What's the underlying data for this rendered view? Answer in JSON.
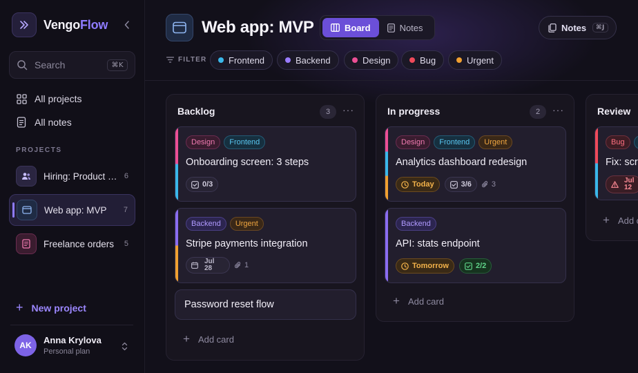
{
  "sidebar": {
    "brand_main": "Vengo",
    "brand_accent": "Flow",
    "search_placeholder": "Search",
    "search_shortcut": "⌘K",
    "nav": [
      {
        "label": "All projects",
        "icon": "grid-icon"
      },
      {
        "label": "All notes",
        "icon": "note-icon"
      }
    ],
    "section_label": "PROJECTS",
    "projects": [
      {
        "name": "Hiring: Product …",
        "count": "6",
        "icon": "people-icon",
        "color": "#2a2540"
      },
      {
        "name": "Web app: MVP",
        "count": "7",
        "icon": "browser-icon",
        "color": "#1f2b44",
        "active": true
      },
      {
        "name": "Freelance orders",
        "count": "5",
        "icon": "document-icon",
        "color": "#3a1c2f"
      }
    ],
    "new_project": "New project",
    "user": {
      "initials": "AK",
      "name": "Anna Krylova",
      "plan": "Personal plan"
    }
  },
  "header": {
    "title": "Web app: MVP",
    "views": [
      {
        "label": "Board",
        "active": true
      },
      {
        "label": "Notes",
        "active": false
      }
    ],
    "notes_button": "Notes",
    "notes_shortcut": "⌘J",
    "filter_label": "FILTER",
    "filters": [
      {
        "label": "Frontend",
        "color": "#3ab8ea"
      },
      {
        "label": "Backend",
        "color": "#9a7cff"
      },
      {
        "label": "Design",
        "color": "#ec4f95"
      },
      {
        "label": "Bug",
        "color": "#ef4a5a"
      },
      {
        "label": "Urgent",
        "color": "#f0a030"
      }
    ]
  },
  "columns": [
    {
      "title": "Backlog",
      "count": "3",
      "more": "···",
      "cards": [
        {
          "tags": [
            "Design",
            "Frontend"
          ],
          "title": "Onboarding screen: 3 steps",
          "checklist": "0/3"
        },
        {
          "tags": [
            "Backend",
            "Urgent"
          ],
          "title": "Stripe payments integration",
          "due_day": "Jul",
          "due_num": "28",
          "attachments": "1"
        },
        {
          "title": "Password reset flow"
        }
      ],
      "add": "Add card"
    },
    {
      "title": "In progress",
      "count": "2",
      "more": "···",
      "cards": [
        {
          "tags": [
            "Design",
            "Frontend",
            "Urgent"
          ],
          "title": "Analytics dashboard redesign",
          "due": "Today",
          "checklist": "3/6",
          "attachments": "3"
        },
        {
          "tags": [
            "Backend"
          ],
          "title": "API: stats endpoint",
          "due": "Tomorrow",
          "checklist": "2/2"
        }
      ],
      "add": "Add card"
    },
    {
      "title": "Review",
      "cards": [
        {
          "tags": [
            "Bug"
          ],
          "title": "Fix: scr",
          "due_day": "Jul",
          "due_num": "12"
        }
      ],
      "add": "Add c"
    }
  ],
  "colors": {
    "accent": "#8e7bff",
    "design": "#ec4f95",
    "frontend": "#3ab8ea",
    "backend": "#8a6cf0",
    "urgent": "#f0a030",
    "bug": "#ef4a5a"
  }
}
